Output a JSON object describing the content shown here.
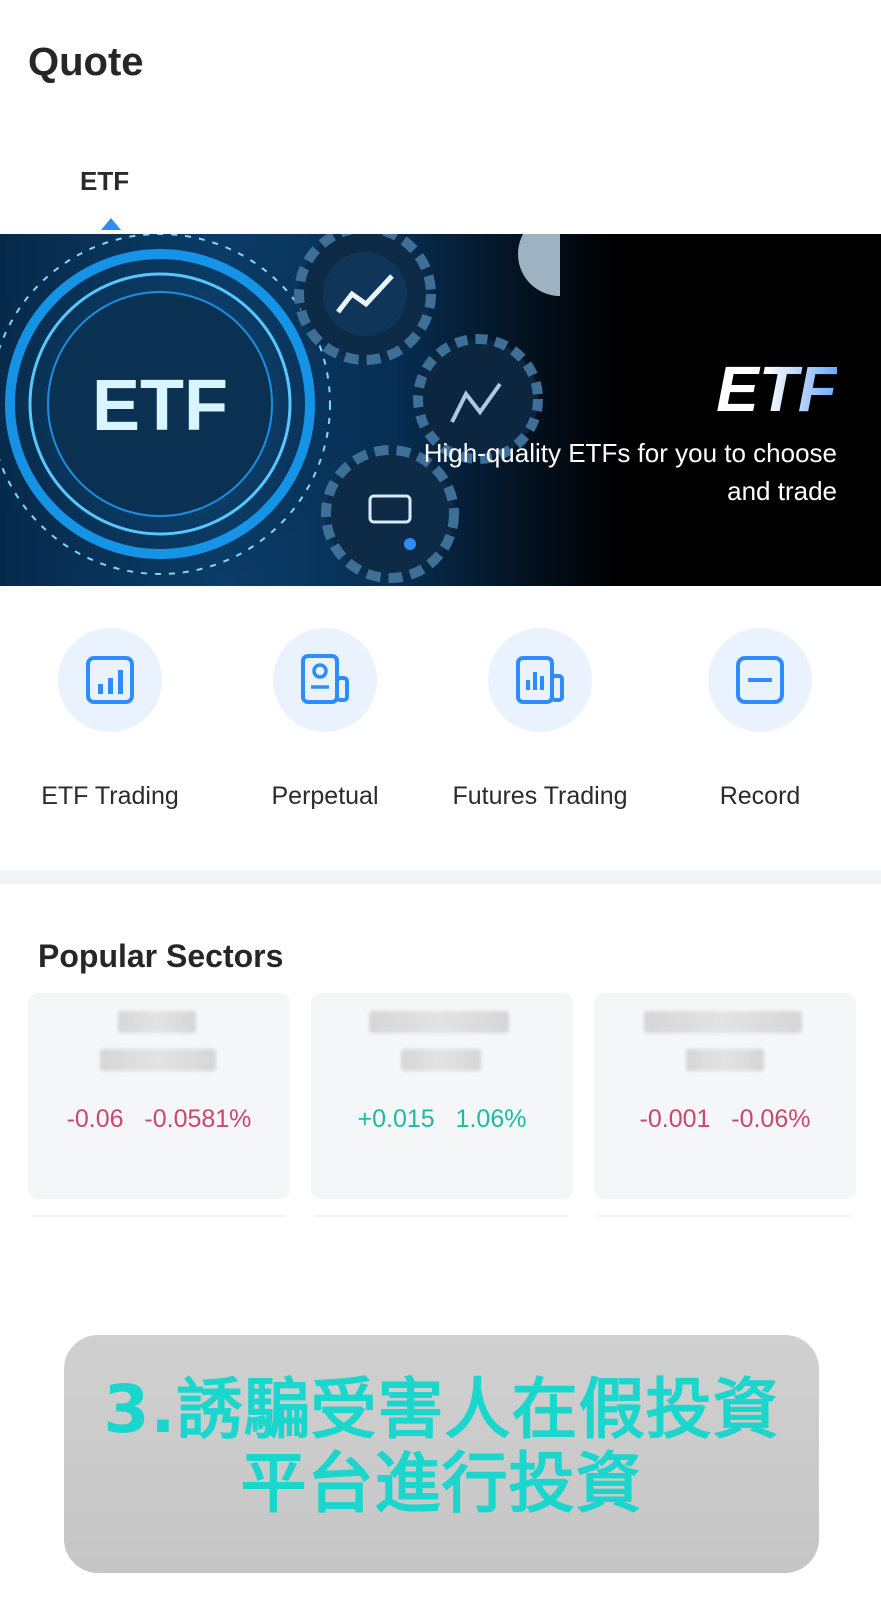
{
  "header": {
    "title": "Quote"
  },
  "tabs": [
    {
      "label": "ETF",
      "active": true
    }
  ],
  "banner": {
    "graphic_text": "ETF",
    "title": "ETF",
    "subtitle": "High-quality ETFs for you to choose and trade"
  },
  "quick_actions": [
    {
      "label": "ETF Trading",
      "icon": "bar-chart-icon"
    },
    {
      "label": "Perpetual",
      "icon": "document-profile-icon"
    },
    {
      "label": "Futures Trading",
      "icon": "chart-document-icon"
    },
    {
      "label": "Record",
      "icon": "minus-square-icon"
    }
  ],
  "popular_sectors": {
    "title": "Popular Sectors",
    "cards": [
      {
        "change": "-0.06",
        "change_pct": "-0.0581%",
        "trend": "down"
      },
      {
        "change": "+0.015",
        "change_pct": "1.06%",
        "trend": "up"
      },
      {
        "change": "-0.001",
        "change_pct": "-0.06%",
        "trend": "down"
      }
    ]
  },
  "caption": {
    "line1": "3.誘騙受害人在假投資",
    "line2": "平台進行投資"
  },
  "colors": {
    "accent": "#2f8cff",
    "negative": "#c9486d",
    "positive": "#22b8a4",
    "caption_text": "#1ad6cc"
  }
}
